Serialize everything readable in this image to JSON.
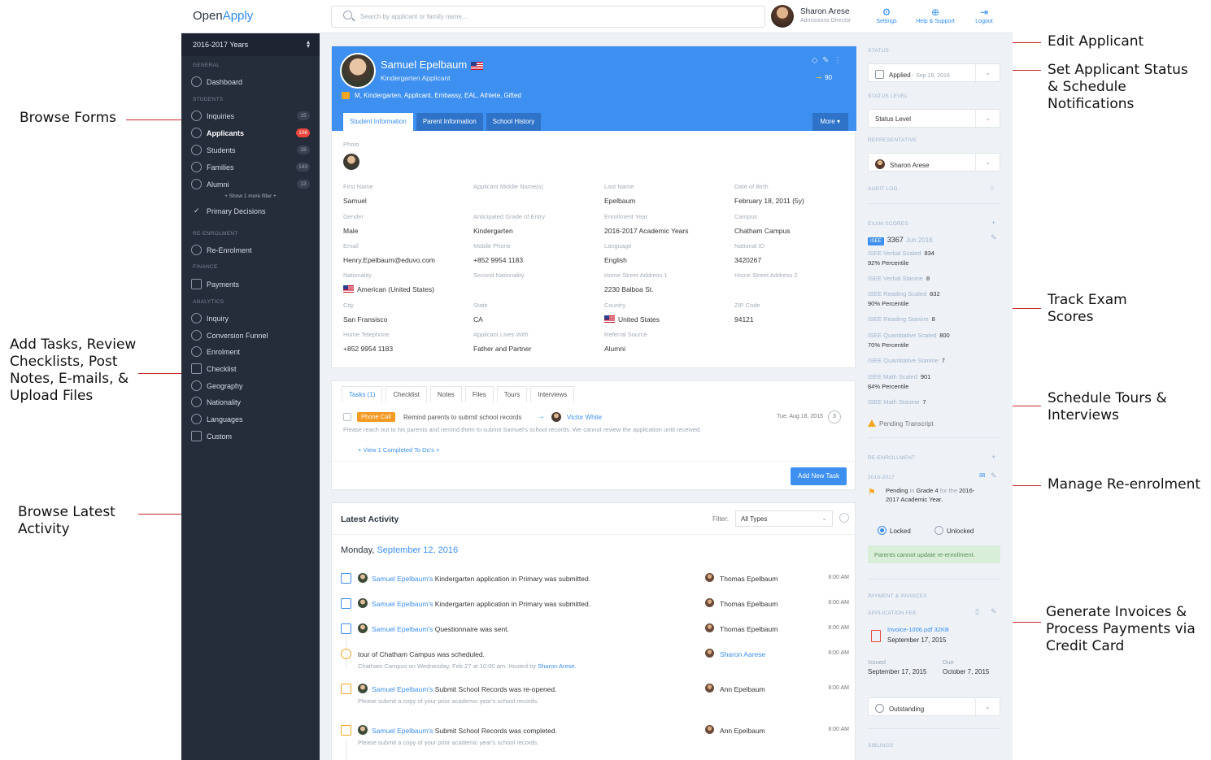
{
  "callouts": {
    "edit_applicant": "Edit Applicant",
    "set_status": "Set Applicant Status\n& Schedule\nNotifications",
    "browse_forms": "Browse Forms",
    "track_exam": "Track Exam\nScores",
    "add_tasks": "Add Tasks, Review\nChecklists, Post\nNotes, E-mails, &\nUpload Files",
    "schedule_tours": "Schedule Tours &\nInterviews",
    "manage_reenrol": "Manage Re-enrolment",
    "browse_activity": "Browse Latest\nActivity",
    "invoices": "Generate Invoices &\nProcess Payments via\nCredit Card"
  },
  "topbar": {
    "logo_a": "Open",
    "logo_b": "Apply",
    "search_placeholder": "Search by applicant or family name...",
    "user_name": "Sharon Arese",
    "user_role": "Admissions Director",
    "settings": "Settings",
    "help": "Help & Support",
    "logout": "Logout"
  },
  "sidebar": {
    "year": "2016-2017 Years",
    "sections": {
      "general": "GENERAL",
      "students": "STUDENTS",
      "reenrol": "RE-ENROLMENT",
      "finance": "FINANCE",
      "analytics": "ANALYTICS"
    },
    "dashboard": "Dashboard",
    "inquiries": {
      "label": "Inquiries",
      "count": "15"
    },
    "applicants": {
      "label": "Applicants",
      "count": "108"
    },
    "students": {
      "label": "Students",
      "count": "28"
    },
    "families": {
      "label": "Families",
      "count": "143"
    },
    "alumni": {
      "label": "Alumni",
      "count": "13"
    },
    "show_more": "+ Show 1 more filter +",
    "primary_decisions": "Primary Decisions",
    "reenrolment": "Re-Enrolment",
    "payments": "Payments",
    "analytics_items": [
      "Inquiry",
      "Conversion Funnel",
      "Enrolment",
      "Checklist",
      "Geography",
      "Nationality",
      "Languages",
      "Custom"
    ]
  },
  "profile": {
    "name": "Samuel Epelbaum",
    "subtitle": "Kindergarten Applicant",
    "tags": "M, Kindergarten, Applicant, Embassy, EAL, Athlete, Gifted",
    "score": "90",
    "tabs": [
      "Student Information",
      "Parent Information",
      "School History"
    ],
    "more": "More ▾",
    "photo_label": "Photo",
    "fields": [
      {
        "label": "First Name",
        "value": "Samuel"
      },
      {
        "label": "Applicant Middle Name(s)",
        "value": ""
      },
      {
        "label": "Last Name",
        "value": "Epelbaum"
      },
      {
        "label": "Date of Birth",
        "value": "February 18, 2011 (5y)"
      },
      {
        "label": "Gender",
        "value": "Male"
      },
      {
        "label": "Anticipated Grade of Entry",
        "value": "Kindergarten"
      },
      {
        "label": "Enrollment Year",
        "value": "2016-2017 Academic Years"
      },
      {
        "label": "Campus",
        "value": "Chatham Campus"
      },
      {
        "label": "Email",
        "value": "Henry.Epelbaum@eduvo.com"
      },
      {
        "label": "Mobile Phone",
        "value": "+852 9954 1183"
      },
      {
        "label": "Language",
        "value": "English"
      },
      {
        "label": "National ID",
        "value": "3420267"
      },
      {
        "label": "Nationality",
        "value": "American (United States)"
      },
      {
        "label": "Second Nationality",
        "value": ""
      },
      {
        "label": "Home Street Address 1",
        "value": "2230 Balboa St."
      },
      {
        "label": "Home Street Address 2",
        "value": ""
      },
      {
        "label": "City",
        "value": "San Fransisco"
      },
      {
        "label": "State",
        "value": "CA"
      },
      {
        "label": "Country",
        "value": "United States"
      },
      {
        "label": "ZIP Code",
        "value": "94121"
      },
      {
        "label": "Home Telephone",
        "value": "+852 9954 1183"
      },
      {
        "label": "Applicant Lives With",
        "value": "Father and Partner"
      },
      {
        "label": "Referral Source",
        "value": "Alumni"
      }
    ]
  },
  "tasks": {
    "tabs": [
      "Tasks (1)",
      "Checklist",
      "Notes",
      "Files",
      "Tours",
      "Interviews"
    ],
    "pill": "Phone Call",
    "text": "Remind parents to submit school records",
    "assignee": "Victor White",
    "date": "Tue, Aug 18, 2015",
    "count": "3",
    "desc": "Please reach out to his parents and remind them to submit Samuel's school records. We cannot review the application until received.",
    "view_completed": "+ View 1 Completed To Do's +",
    "add_button": "Add New Task"
  },
  "activity": {
    "title": "Latest Activity",
    "filter_label": "Filter:",
    "filter_value": "All Types",
    "day_a": "Monday,",
    "day_b": "September 12, 2016",
    "rows": [
      {
        "who": "Samuel Epelbaum's",
        "text": "Kindergarten application in Primary was submitted.",
        "sub": "",
        "person": "Thomas Epelbaum",
        "time": "8:00 AM"
      },
      {
        "who": "Samuel Epelbaum's",
        "text": "Kindergarten application in Primary was submitted.",
        "sub": "",
        "person": "Thomas Epelbaum",
        "time": "8:00 AM"
      },
      {
        "who": "Samuel Epelbaum's",
        "text": "Questionnaire was sent.",
        "sub": "",
        "person": "Thomas Epelbaum",
        "time": "8:00 AM"
      },
      {
        "who": "",
        "text": "tour of Chatham Campus was scheduled.",
        "sub": "Chatham Campus on Wednesday, Feb 27 at 10:00 am. Hosted by",
        "sub_link": "Sharon Arese.",
        "person": "Sharon Aarese",
        "time": "8:00 AM"
      },
      {
        "who": "Samuel Epelbaum's",
        "text": "Submit School Records was re-opened.",
        "sub": "Please submit a copy of your prior academic year's school records.",
        "person": "Ann Epelbaum",
        "time": "8:00 AM"
      },
      {
        "who": "Samuel Epelbaum's",
        "text": "Submit School Records was completed.",
        "sub": "Please submit a copy of your prior academic year's school records.",
        "person": "Ann Epelbaum",
        "time": "8:00 AM"
      }
    ]
  },
  "right": {
    "status_label": "STATUS",
    "status_value": "Applied",
    "status_date": "- Sep 16, 2016",
    "status_level_label": "STATUS LEVEL",
    "status_level_value": "Status Level",
    "rep_label": "REPRESENTATIVE",
    "rep_value": "Sharon Arese",
    "audit_label": "AUDIT LOG",
    "exam_label": "EXAM SCORES",
    "isee_badge": "ISEE",
    "isee_score": "3367",
    "isee_date": "Jun 2016",
    "exams": [
      {
        "name": "ISEE Verbal Scaled",
        "value": "834",
        "pct": "92% Percentile"
      },
      {
        "name": "ISEE Verbal Stanine",
        "value": "8",
        "pct": ""
      },
      {
        "name": "ISEE Reading Scaled",
        "value": "832",
        "pct": "90% Percentile"
      },
      {
        "name": "ISEE Reading Stanine",
        "value": "8",
        "pct": ""
      },
      {
        "name": "ISEE Quantitative Scaled",
        "value": "800",
        "pct": "70% Percentile"
      },
      {
        "name": "ISEE Quantitative Stanine",
        "value": "7",
        "pct": ""
      },
      {
        "name": "ISEE Math Scaled",
        "value": "901",
        "pct": "84% Percentile"
      },
      {
        "name": "ISEE Math Stanine",
        "value": "7",
        "pct": ""
      }
    ],
    "pending_transcript": "Pending Transcript",
    "reenrol_label": "RE-ENROLLMENT",
    "reenrol_year": "2016-2017",
    "reenrol_a": "Pending",
    "reenrol_b": " in ",
    "reenrol_c": "Grade 4",
    "reenrol_d": " for the ",
    "reenrol_e": "2016-2017 Academic Year.",
    "locked": "Locked",
    "unlocked": "Unlocked",
    "notice": "Parents cannot update re-enrollment.",
    "payments_label": "PAYMENT & INVOICES",
    "app_fee_label": "APPLICATION FEE",
    "invoice_file": "Invoice-1006.pdf 32KB",
    "invoice_date": "September 17, 2015",
    "issued_label": "Issued",
    "issued_value": "September 17, 2015",
    "due_label": "Due",
    "due_value": "October 7, 2015",
    "invoice_status": "Outstanding",
    "siblings_label": "SIBLINGS"
  }
}
